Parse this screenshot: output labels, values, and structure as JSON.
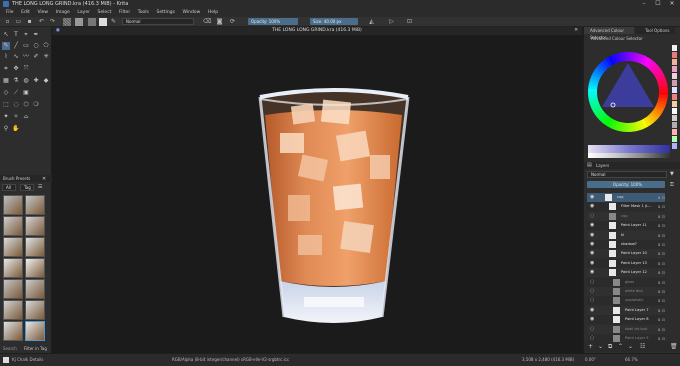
{
  "window": {
    "title": "THE LONG LONG GRIND.kra (416.3 MiB) - Krita",
    "controls": [
      "–",
      "☐",
      "✕"
    ]
  },
  "menu": [
    "File",
    "Edit",
    "View",
    "Image",
    "Layer",
    "Select",
    "Filter",
    "Tools",
    "Settings",
    "Window",
    "Help"
  ],
  "toolbar": {
    "blend_mode": "Normal",
    "opacity_label": "Opacity: 100%",
    "size_label": "Size: 40.00 px"
  },
  "document": {
    "tab_title": "THE LONG LONG GRIND.kra (416.3 MiB)"
  },
  "brush_presets": {
    "title": "Brush Presets",
    "tag_label": "All",
    "filter_label": "Tag",
    "footer_search": "Search",
    "footer_filter": "Filter in Tag"
  },
  "color_panel": {
    "tab1": "Advanced Colour Selector",
    "tab2": "Tool Options",
    "subtitle": "Advanced Colour Selector"
  },
  "layers_panel": {
    "title": "Layers",
    "blend_mode": "Normal",
    "opacity_label": "Opacity: 100%",
    "layers": [
      {
        "name": "cup",
        "visible": true,
        "selected": true
      },
      {
        "name": "Filter Mask 1 (L...",
        "visible": true
      },
      {
        "name": "cup",
        "visible": false
      },
      {
        "name": "Paint Layer 11",
        "visible": true
      },
      {
        "name": "hl",
        "visible": true
      },
      {
        "name": "shadow?",
        "visible": true
      },
      {
        "name": "Paint Layer 10",
        "visible": true
      },
      {
        "name": "Paint Layer 13",
        "visible": true
      },
      {
        "name": "Paint Layer 12",
        "visible": true
      },
      {
        "name": "glass",
        "visible": false
      },
      {
        "name": "white blur",
        "visible": false
      },
      {
        "name": "upplaisdlv",
        "visible": false
      },
      {
        "name": "Paint Layer 7",
        "visible": true
      },
      {
        "name": "Paint Layer 8",
        "visible": true
      },
      {
        "name": "shall let lock",
        "visible": false
      },
      {
        "name": "Paint Layer 5",
        "visible": false
      }
    ]
  },
  "status": {
    "brush": "Kj Chalk Details",
    "color_info": "RGB/Alpha (8-bit integer/channel)  sRGB-elle-V2-srgbtrc.icc",
    "dimensions": "3,508 x 2,480 (416.3 MiB)",
    "rotation": "0.00°",
    "zoom": "66.7%"
  },
  "accent_color": "#4a6d8c",
  "palette_colors": [
    "#f0f0f0",
    "#e87a7a",
    "#f2b2a0",
    "#e8a0c8",
    "#f4d0d8",
    "#c8a0b0",
    "#e0e0ff",
    "#f08080",
    "#f0d0a0",
    "#ffffff",
    "#d0d0d0",
    "#b0b0b0",
    "#ffb0b0",
    "#b0ffb0",
    "#b0b0ff"
  ]
}
